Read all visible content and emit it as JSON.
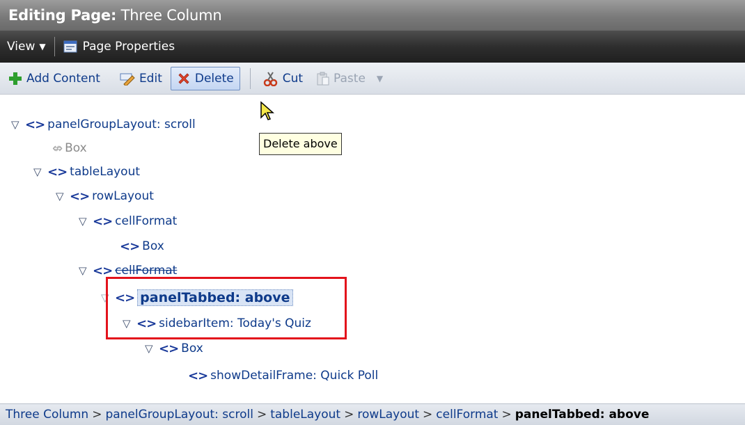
{
  "title": {
    "label": "Editing Page:",
    "name": "Three Column"
  },
  "menubar": {
    "view_label": "View",
    "page_properties_label": "Page Properties"
  },
  "toolbar": {
    "add_content": "Add Content",
    "edit": "Edit",
    "delete": "Delete",
    "cut": "Cut",
    "paste": "Paste"
  },
  "tooltip": "Delete above",
  "tree": {
    "n1": "panelGroupLayout: scroll",
    "n2": "Box",
    "n3": "tableLayout",
    "n4": "rowLayout",
    "n5": "cellFormat",
    "n6": "Box",
    "n7": "cellFormat",
    "n8": "panelTabbed: above",
    "n9": "sidebarItem: Today's Quiz",
    "n10": "Box",
    "n11": "showDetailFrame: Quick Poll"
  },
  "breadcrumb": {
    "c1": "Three Column",
    "c2": "panelGroupLayout: scroll",
    "c3": "tableLayout",
    "c4": "rowLayout",
    "c5": "cellFormat",
    "current": "panelTabbed: above",
    "sep": ">"
  },
  "colors": {
    "accent": "#0e3a8a",
    "highlight_box": "#e3131c",
    "tooltip_bg": "#ffffe1"
  },
  "icons": {
    "add": "plus-icon",
    "edit": "pencil-icon",
    "delete": "red-x-icon",
    "cut": "scissors-icon",
    "paste": "clipboard-icon",
    "tag": "angle-brackets-icon",
    "expand": "triangle-down-icon"
  }
}
